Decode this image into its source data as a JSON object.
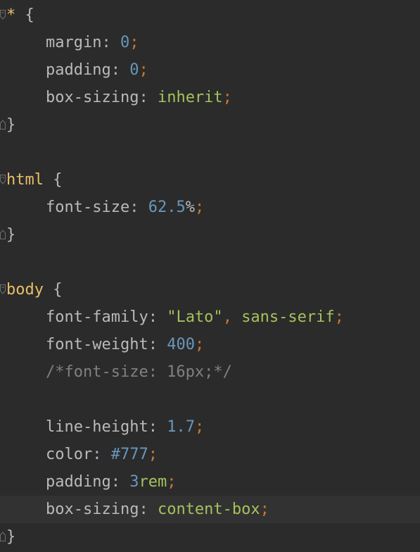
{
  "editor": {
    "language": "CSS",
    "lines": [
      {
        "selector": "*",
        "open": "{"
      },
      {
        "prop": "margin",
        "value": "0"
      },
      {
        "prop": "padding",
        "value": "0"
      },
      {
        "prop": "box-sizing",
        "value": "inherit"
      },
      {
        "close": "}"
      },
      {},
      {
        "selector": "html",
        "open": "{"
      },
      {
        "prop": "font-size",
        "value_num": "62.5",
        "value_unit": "%"
      },
      {
        "close": "}"
      },
      {},
      {
        "selector": "body",
        "open": "{"
      },
      {
        "prop": "font-family",
        "value_str": "\"Lato\"",
        "value_rest": "sans-serif"
      },
      {
        "prop": "font-weight",
        "value": "400"
      },
      {
        "comment": "/*font-size: 16px;*/"
      },
      {},
      {
        "prop": "line-height",
        "value": "1.7"
      },
      {
        "prop": "color",
        "value": "#777"
      },
      {
        "prop": "padding",
        "value_num": "3",
        "value_unit": "rem"
      },
      {
        "prop": "box-sizing",
        "value": "content-box"
      },
      {
        "close": "}"
      }
    ],
    "current_line": 18,
    "colors": {
      "background": "#2b2b2b",
      "current_line": "#323232",
      "selector": "#e8bf6a",
      "property": "#bababa",
      "number": "#6897bb",
      "keyword": "#a5c25c",
      "punctuation": "#cc7832",
      "comment": "#808080"
    }
  }
}
